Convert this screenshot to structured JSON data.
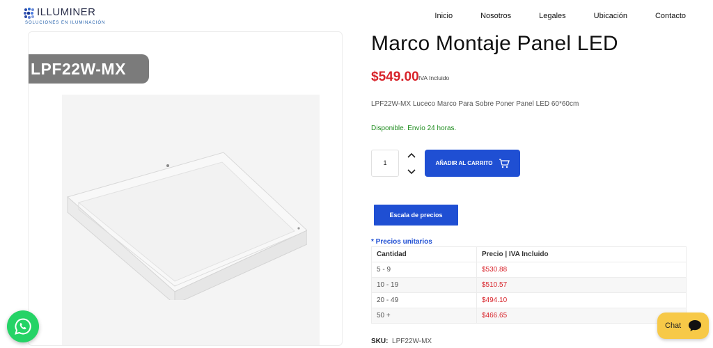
{
  "header": {
    "logo_text": "ILLUMINER",
    "logo_subtitle": "SOLUCIONES EN ILUMINACIÓN",
    "nav": [
      "Inicio",
      "Nosotros",
      "Legales",
      "Ubicación",
      "Contacto"
    ]
  },
  "product": {
    "image_sku_label": "LPF22W-MX",
    "title": "Marco Montaje Panel LED",
    "price": "$549.00",
    "price_note": "IVA Incluido",
    "description": "LPF22W-MX Luceco Marco Para Sobre Poner Panel LED 60*60cm",
    "stock": "Disponible. Envío 24 horas.",
    "quantity": "1",
    "add_to_cart_label": "AÑADIR AL CARRITO",
    "scale_button_label": "Escala de precios",
    "unit_prices_label": "* Precios unitarios",
    "sku_label": "SKU:",
    "sku_value": "LPF22W-MX"
  },
  "price_table": {
    "headers": [
      "Cantidad",
      "Precio | IVA Incluido"
    ],
    "rows": [
      {
        "qty": "5 - 9",
        "price": "$530.88"
      },
      {
        "qty": "10 - 19",
        "price": "$510.57"
      },
      {
        "qty": "20 - 49",
        "price": "$494.10"
      },
      {
        "qty": "50 +",
        "price": "$466.65"
      }
    ]
  },
  "floating": {
    "chat_label": "Chat"
  },
  "colors": {
    "accent_blue": "#1f4fd3",
    "price_red": "#d8232a",
    "stock_green": "#1e8c1e",
    "whatsapp_green": "#25d366",
    "chat_yellow": "#f7c948"
  },
  "icons": {
    "cart": "cart-icon",
    "whatsapp": "whatsapp-icon",
    "chat": "chat-bubble-icon",
    "qty_up": "chevron-up-icon",
    "qty_down": "chevron-down-icon"
  }
}
